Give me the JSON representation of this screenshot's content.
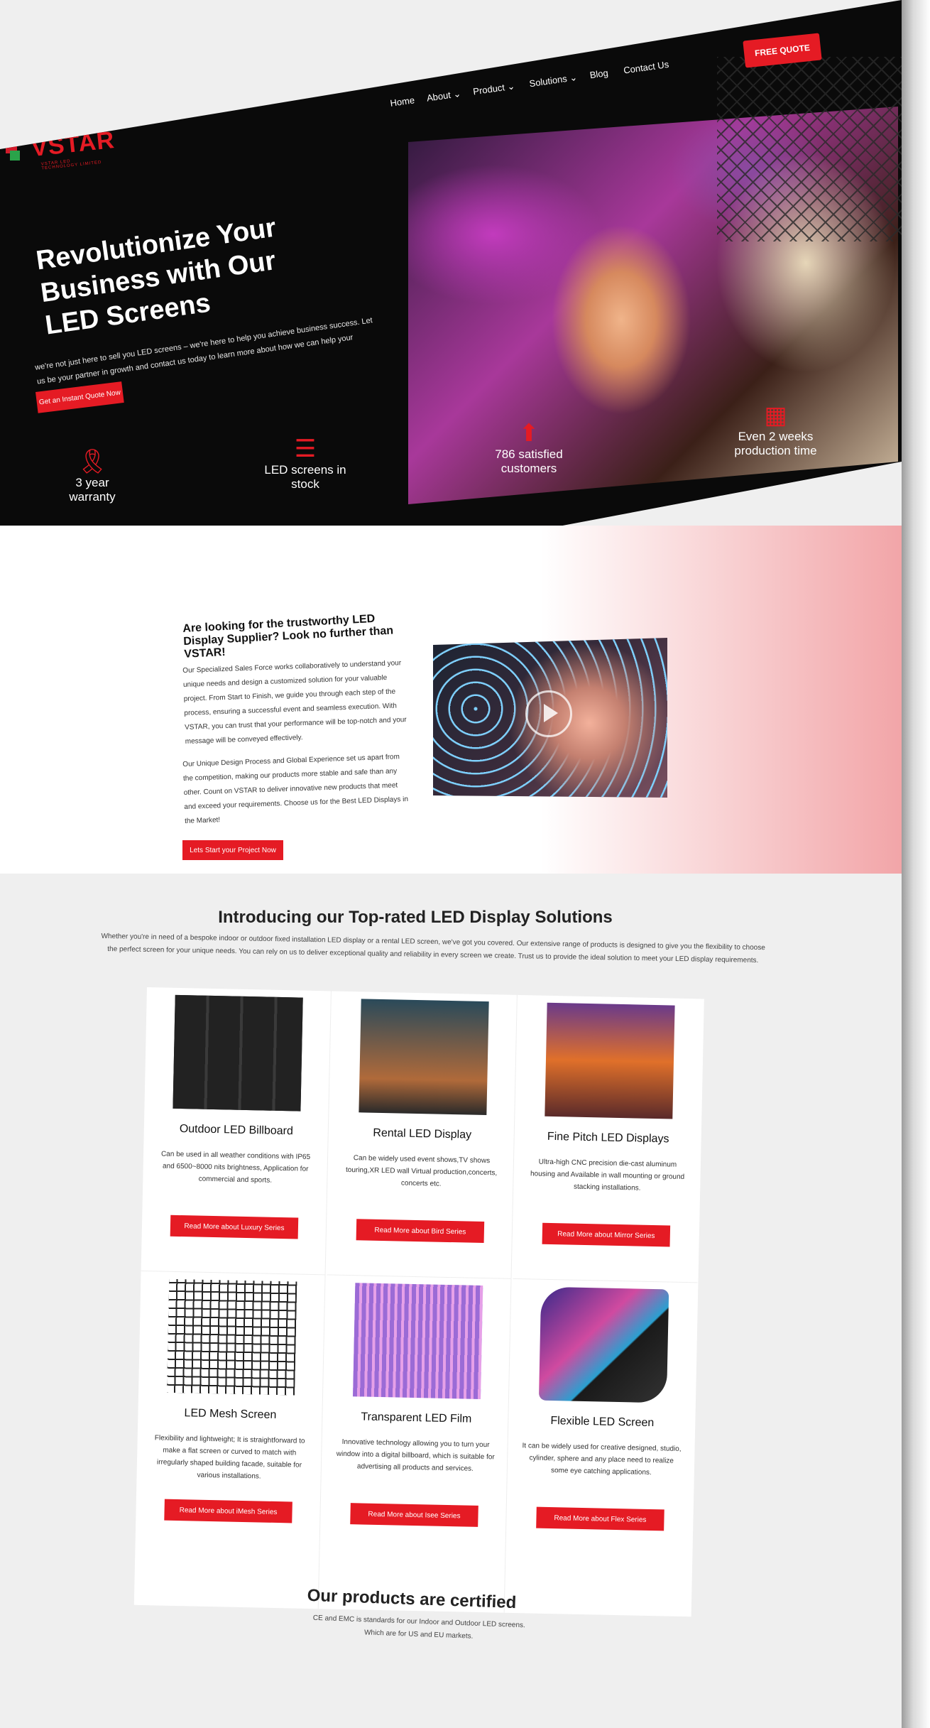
{
  "nav": {
    "logo_text": "VSTAR",
    "logo_sub": "VSTAR LED TECHNOLOGY LIMITED",
    "items": [
      "Home",
      "About",
      "Product",
      "Solutions",
      "Blog",
      "Contact Us"
    ],
    "dropdown_marker": "⌄",
    "free_quote": "FREE QUOTE"
  },
  "hero": {
    "title": "Revolutionize Your Business with Our LED Screens",
    "description": "we're not just here to sell you LED screens – we're here to help you achieve business success. Let us be your partner in growth and contact us today to learn more about how we can help your business thrive!",
    "cta": "Get an Instant Quote Now",
    "stats": [
      {
        "icon": "ribbon-icon",
        "glyph": "🎗",
        "text": "3 year warranty"
      },
      {
        "icon": "stack-icon",
        "glyph": "☰",
        "text": "LED screens in stock"
      },
      {
        "icon": "pin-icon",
        "glyph": "⬆",
        "text": "786 satisfied customers"
      },
      {
        "icon": "calendar-icon",
        "glyph": "▦",
        "text": "Even 2 weeks production time"
      }
    ]
  },
  "about": {
    "title": "Are looking for the trustworthy LED Display Supplier? Look no further than VSTAR!",
    "p1": "Our Specialized Sales Force works collaboratively to understand your unique needs and design a customized solution for your valuable project. From Start to Finish, we guide you through each step of the process, ensuring a successful event and seamless execution. With VSTAR, you can trust that your performance will be top-notch and your message will be conveyed effectively.",
    "p2": "Our Unique Design Process and Global Experience set us apart from the competition, making our products more stable and safe than any other. Count on VSTAR to deliver innovative new products that meet and exceed your requirements. Choose us for the Best LED Displays in the Market!",
    "button": "Lets Start your Project Now"
  },
  "products": {
    "title": "Introducing our Top-rated LED Display Solutions",
    "description": "Whether you're in need of a bespoke indoor or outdoor fixed installation LED display or a rental LED screen, we've got you covered. Our extensive range of products is designed to give you the flexibility to choose the perfect screen for your unique needs. You can rely on us to deliver exceptional quality and reliability in every screen we create. Trust us to provide the ideal solution to meet your LED display requirements.",
    "cards": [
      {
        "title": "Outdoor LED Billboard",
        "desc": "Can be used in all weather conditions with IP65 and 6500~8000 nits brightness, Application for commercial and sports.",
        "button": "Read More about Luxury Series"
      },
      {
        "title": "Rental LED Display",
        "desc": "Can be widely used event shows,TV shows touring,XR LED wall Virtual production,concerts, concerts etc.",
        "button": "Read More about Bird Series"
      },
      {
        "title": "Fine Pitch LED Displays",
        "desc": "Ultra-high CNC precision die-cast aluminum housing and Available in wall mounting or ground stacking installations.",
        "button": "Read More about Mirror Series"
      },
      {
        "title": "LED Mesh Screen",
        "desc": "Flexibility and lightweight; It is straightforward to make a flat screen or curved to match with irregularly shaped building facade, suitable for various installations.",
        "button": "Read More about iMesh Series"
      },
      {
        "title": "Transparent LED Film",
        "desc": "Innovative technology allowing you to turn your window into a digital billboard, which is suitable for advertising all products and services.",
        "button": "Read More about Isee Series"
      },
      {
        "title": "Flexible LED Screen",
        "desc": "It can be widely used for creative designed, studio, cylinder, sphere and any place need to realize some eye catching applications.",
        "button": "Read More about Flex Series"
      }
    ]
  },
  "certified": {
    "title": "Our products are certified",
    "line1": "CE and EMC is standards for our Indoor and Outdoor LED screens.",
    "line2": "Which are for US and EU markets."
  },
  "colors": {
    "accent": "#e51b24",
    "hero_bg": "#0a0a0a"
  }
}
